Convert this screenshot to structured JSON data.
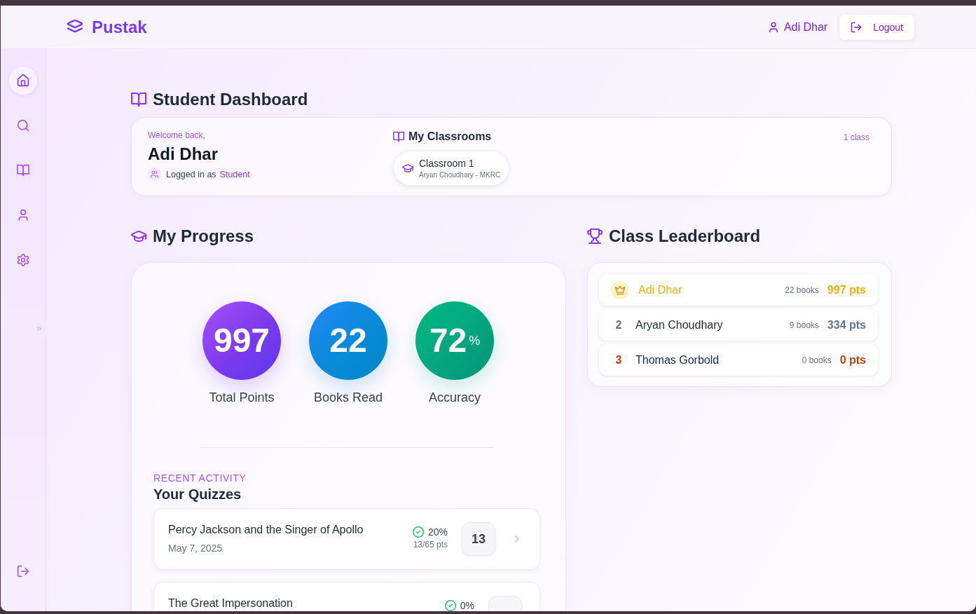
{
  "header": {
    "brand": "Pustak",
    "user": "Adi Dhar",
    "logout": "Logout"
  },
  "sidebar": {
    "items": [
      {
        "kind": "home",
        "selected": true
      },
      {
        "kind": "search",
        "selected": false
      },
      {
        "kind": "books",
        "selected": false
      },
      {
        "kind": "profile",
        "selected": false
      },
      {
        "kind": "settings",
        "selected": false
      }
    ]
  },
  "dashboard": {
    "title": "Student Dashboard",
    "welcome": {
      "greeting": "Welcome back,",
      "name": "Adi Dhar",
      "role_prefix": "Logged in as",
      "role": "Student"
    },
    "classrooms": {
      "title": "My Classrooms",
      "count": "1 class",
      "items": [
        {
          "name": "Classroom 1",
          "teacher": "Aryan Choudhary - MKRC"
        }
      ]
    }
  },
  "progress": {
    "title": "My Progress",
    "stats": [
      {
        "kind": "points",
        "value": "997",
        "label": "Total Points"
      },
      {
        "kind": "books",
        "value": "22",
        "label": "Books Read"
      },
      {
        "kind": "accuracy",
        "value": "72",
        "unit": "%",
        "label": "Accuracy"
      }
    ],
    "activity": {
      "eyebrow": "RECENT ACTIVITY",
      "title": "Your Quizzes",
      "quizzes": [
        {
          "title": "Percy Jackson and the Singer of Apollo",
          "date": "May 7, 2025",
          "percent": "20%",
          "points": "13/65 pts",
          "score": "13"
        },
        {
          "title": "The Great Impersonation",
          "percent": "0%"
        }
      ]
    }
  },
  "leaderboard": {
    "title": "Class Leaderboard",
    "rows": [
      {
        "kind": "crown",
        "name": "Adi Dhar",
        "books": "22 books",
        "points": "997 pts",
        "color": "#eab308"
      },
      {
        "kind": "rank",
        "rank": "2",
        "name": "Aryan Choudhary",
        "books": "9 books",
        "points": "334 pts",
        "color": "#64748b"
      },
      {
        "kind": "rank",
        "rank": "3",
        "name": "Thomas Gorbold",
        "books": "0 books",
        "points": "0 pts",
        "color": "#c2410c"
      }
    ]
  }
}
